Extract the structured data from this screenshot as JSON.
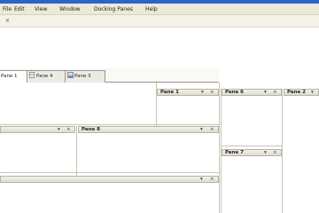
{
  "menu": [
    "File",
    "Edit",
    "View",
    "Window",
    "Docking Panes",
    "Help"
  ],
  "pane_strip": {
    "label": ""
  },
  "tabs": [
    "Pane 1",
    "Pane 4",
    "Pane 3"
  ],
  "panes": {
    "pane1": "Pane 1",
    "pane6": "Pane 6",
    "pane2": "Pane 2",
    "paneLeft": "",
    "pane8": "Pane 8",
    "pane7": "Pane 7",
    "paneBottom": ""
  },
  "glyphs": {
    "pin": "▾",
    "close": "×"
  }
}
